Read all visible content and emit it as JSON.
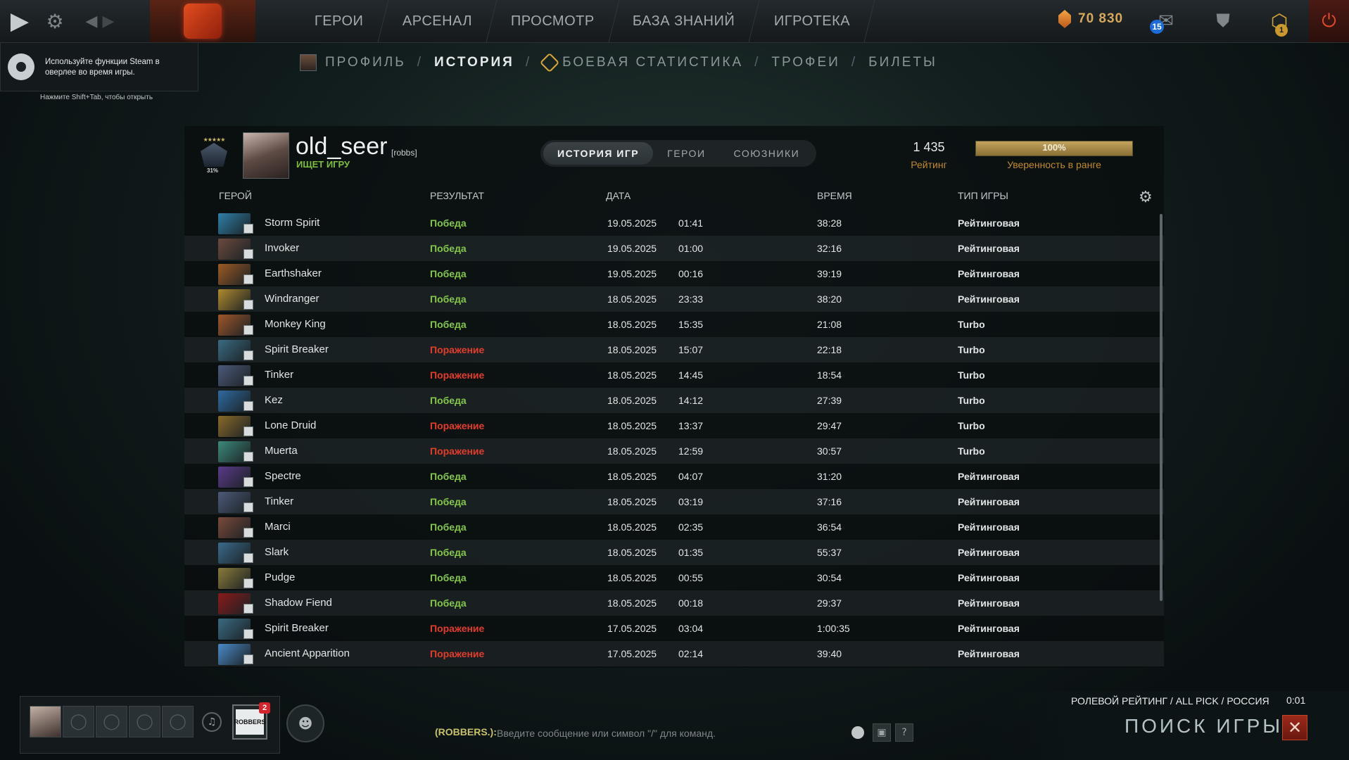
{
  "top_nav": {
    "items": [
      "ГЕРОИ",
      "АРСЕНАЛ",
      "ПРОСМОТР",
      "БАЗА ЗНАНИЙ",
      "ИГРОТЕКА"
    ],
    "shards": "70 830",
    "mail_count": "15",
    "plus_badge": "1"
  },
  "steam_overlay": {
    "message": "Используйте функции Steam в оверлее во время игры.",
    "hint": "Нажмите Shift+Tab, чтобы открыть"
  },
  "sub_nav": {
    "profile": "ПРОФИЛЬ",
    "history": "ИСТОРИЯ",
    "battle_stats": "БОЕВАЯ СТАТИСТИКА",
    "trophies": "ТРОФЕИ",
    "tickets": "БИЛЕТЫ",
    "separator": "/"
  },
  "profile": {
    "name": "old_seer",
    "clan_tag": "[robbs]",
    "status": "ИЩЕТ ИГРУ",
    "rank_percent": "31%",
    "rank_stars": "★★★★★"
  },
  "tabs": [
    "ИСТОРИЯ ИГР",
    "ГЕРОИ",
    "СОЮЗНИКИ"
  ],
  "rating": {
    "value": "1 435",
    "label": "Рейтинг"
  },
  "confidence": {
    "percent_text": "100%",
    "fraction": 1.0,
    "label": "Уверенность в ранге"
  },
  "table": {
    "headers": {
      "hero": "ГЕРОЙ",
      "result": "РЕЗУЛЬТАТ",
      "date": "ДАТА",
      "duration": "ВРЕМЯ",
      "type": "ТИП ИГРЫ"
    },
    "rows": [
      {
        "hero": "Storm Spirit",
        "result": "Победа",
        "win": true,
        "date": "19.05.2025",
        "time": "01:41",
        "duration": "38:28",
        "type": "Рейтинговая",
        "color": "#2e7fa8"
      },
      {
        "hero": "Invoker",
        "result": "Победа",
        "win": true,
        "date": "19.05.2025",
        "time": "01:00",
        "duration": "32:16",
        "type": "Рейтинговая",
        "color": "#6c4a3e"
      },
      {
        "hero": "Earthshaker",
        "result": "Победа",
        "win": true,
        "date": "19.05.2025",
        "time": "00:16",
        "duration": "39:19",
        "type": "Рейтинговая",
        "color": "#9c5a24"
      },
      {
        "hero": "Windranger",
        "result": "Победа",
        "win": true,
        "date": "18.05.2025",
        "time": "23:33",
        "duration": "38:20",
        "type": "Рейтинговая",
        "color": "#b08a2e"
      },
      {
        "hero": "Monkey King",
        "result": "Победа",
        "win": true,
        "date": "18.05.2025",
        "time": "15:35",
        "duration": "21:08",
        "type": "Turbo",
        "color": "#a0562a"
      },
      {
        "hero": "Spirit Breaker",
        "result": "Поражение",
        "win": false,
        "date": "18.05.2025",
        "time": "15:07",
        "duration": "22:18",
        "type": "Turbo",
        "color": "#3a6a82"
      },
      {
        "hero": "Tinker",
        "result": "Поражение",
        "win": false,
        "date": "18.05.2025",
        "time": "14:45",
        "duration": "18:54",
        "type": "Turbo",
        "color": "#4d5a7a"
      },
      {
        "hero": "Kez",
        "result": "Победа",
        "win": true,
        "date": "18.05.2025",
        "time": "14:12",
        "duration": "27:39",
        "type": "Turbo",
        "color": "#2f6aa0"
      },
      {
        "hero": "Lone Druid",
        "result": "Поражение",
        "win": false,
        "date": "18.05.2025",
        "time": "13:37",
        "duration": "29:47",
        "type": "Turbo",
        "color": "#8a6a2a"
      },
      {
        "hero": "Muerta",
        "result": "Поражение",
        "win": false,
        "date": "18.05.2025",
        "time": "12:59",
        "duration": "30:57",
        "type": "Turbo",
        "color": "#3c8a7a"
      },
      {
        "hero": "Spectre",
        "result": "Победа",
        "win": true,
        "date": "18.05.2025",
        "time": "04:07",
        "duration": "31:20",
        "type": "Рейтинговая",
        "color": "#5a3a8a"
      },
      {
        "hero": "Tinker",
        "result": "Победа",
        "win": true,
        "date": "18.05.2025",
        "time": "03:19",
        "duration": "37:16",
        "type": "Рейтинговая",
        "color": "#4d5a7a"
      },
      {
        "hero": "Marci",
        "result": "Победа",
        "win": true,
        "date": "18.05.2025",
        "time": "02:35",
        "duration": "36:54",
        "type": "Рейтинговая",
        "color": "#7a4a3a"
      },
      {
        "hero": "Slark",
        "result": "Победа",
        "win": true,
        "date": "18.05.2025",
        "time": "01:35",
        "duration": "55:37",
        "type": "Рейтинговая",
        "color": "#3a6a8a"
      },
      {
        "hero": "Pudge",
        "result": "Победа",
        "win": true,
        "date": "18.05.2025",
        "time": "00:55",
        "duration": "30:54",
        "type": "Рейтинговая",
        "color": "#8a7a3a"
      },
      {
        "hero": "Shadow Fiend",
        "result": "Победа",
        "win": true,
        "date": "18.05.2025",
        "time": "00:18",
        "duration": "29:37",
        "type": "Рейтинговая",
        "color": "#8a1a1a"
      },
      {
        "hero": "Spirit Breaker",
        "result": "Поражение",
        "win": false,
        "date": "17.05.2025",
        "time": "03:04",
        "duration": "1:00:35",
        "type": "Рейтинговая",
        "color": "#3a6a82"
      },
      {
        "hero": "Ancient Apparition",
        "result": "Поражение",
        "win": false,
        "date": "17.05.2025",
        "time": "02:14",
        "duration": "39:40",
        "type": "Рейтинговая",
        "color": "#4a8ac8"
      }
    ]
  },
  "party": {
    "team_badge": "2",
    "team_logo_text": "ROBBERS"
  },
  "chat": {
    "channel": "(ROBBERS.):",
    "placeholder": "Введите сообщение или символ \"/\" для команд."
  },
  "search": {
    "mode": "РОЛЕВОЙ РЕЙТИНГ / ALL PICK / РОССИЯ",
    "timer": "0:01",
    "title": "ПОИСК ИГРЫ"
  },
  "icons": [
    "play-icon",
    "gear-icon",
    "chevron-left-icon",
    "chevron-right-icon",
    "dota-logo-icon",
    "shard-icon",
    "mail-icon",
    "armory-icon",
    "dota-plus-icon",
    "power-icon",
    "steam-icon",
    "headset-icon",
    "social-icon",
    "emoji-icon",
    "screenshot-icon",
    "help-icon",
    "close-icon"
  ]
}
